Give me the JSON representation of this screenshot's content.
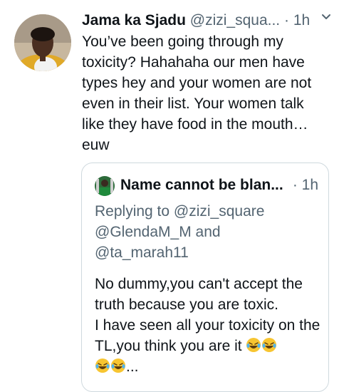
{
  "tweet": {
    "author_name": "Jama ka Sjadu",
    "handle": "@zizi_squa...",
    "separator": "·",
    "time": "1h",
    "text": "You’ve been going through my toxicity? Hahahaha our men have types hey and your women are not even in their list. Your women talk like they have food in the mouth… euw"
  },
  "quote": {
    "author_name": "Name cannot be blan...",
    "time": "· 1h",
    "reply_prefix": "Replying to",
    "mentions": [
      "@zizi_square",
      "@GlendaM_M",
      "@ta_marah11"
    ],
    "and_word": "and",
    "text_line1": "No dummy,you can't accept the truth because you are toxic.",
    "text_line2": "I have seen all your toxicity on the TL,you think you are it",
    "text_end": "..."
  },
  "icons": {
    "emoji": "face-with-tears-of-joy",
    "more": "chevron-down-icon"
  }
}
